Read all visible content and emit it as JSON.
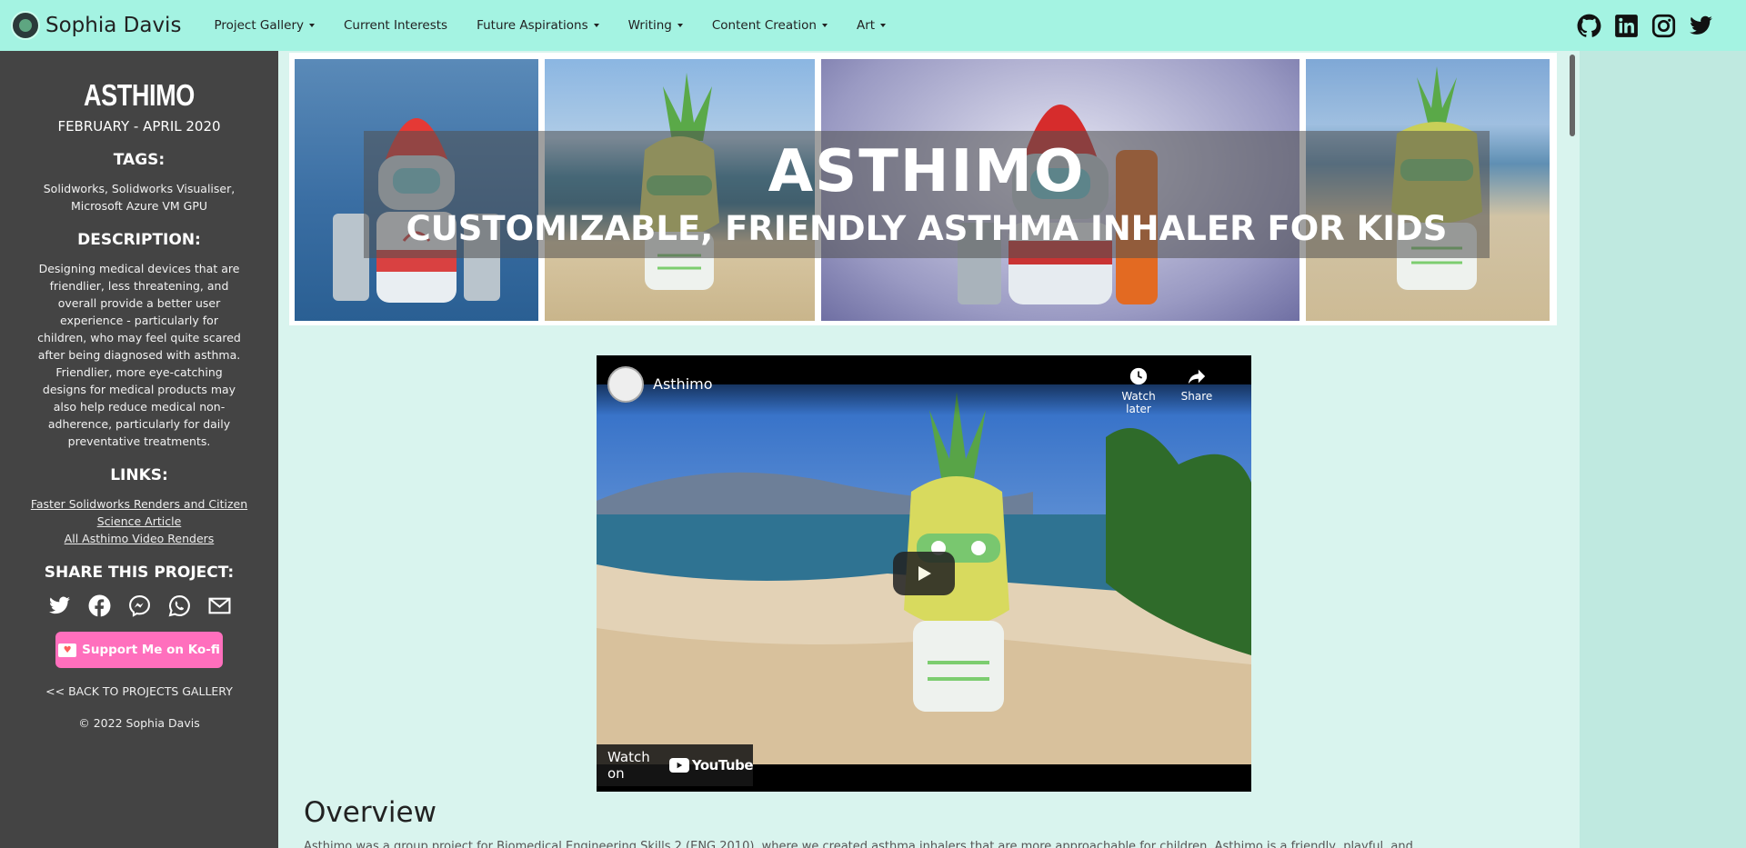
{
  "nav": {
    "brand": "Sophia Davis",
    "items": [
      {
        "label": "Project Gallery",
        "dropdown": true
      },
      {
        "label": "Current Interests",
        "dropdown": false
      },
      {
        "label": "Future Aspirations",
        "dropdown": true
      },
      {
        "label": "Writing",
        "dropdown": true
      },
      {
        "label": "Content Creation",
        "dropdown": true
      },
      {
        "label": "Art",
        "dropdown": true
      }
    ],
    "social_icons": [
      "github-icon",
      "linkedin-icon",
      "instagram-icon",
      "twitter-icon"
    ]
  },
  "sidebar": {
    "title": "ASTHIMO",
    "dates": "FEBRUARY - APRIL 2020",
    "tags_heading": "TAGS:",
    "tags": "Solidworks, Solidworks Visualiser, Microsoft Azure VM GPU",
    "description_heading": "DESCRIPTION:",
    "description": "Designing medical devices that are friendlier, less threatening, and overall provide a better user experience - particularly for children, who may feel quite scared after being diagnosed with asthma. Friendlier, more eye-catching designs for medical products may also help reduce medical non-adherence, particularly for daily preventative treatments.",
    "links_heading": "LINKS:",
    "links": [
      "Faster Solidworks Renders and Citizen Science Article",
      "All Asthimo Video Renders"
    ],
    "share_heading": "SHARE THIS PROJECT:",
    "share_icons": [
      "twitter-icon",
      "facebook-icon",
      "messenger-icon",
      "whatsapp-icon",
      "email-icon"
    ],
    "kofi_label": "Support Me on Ko-fi",
    "back_label": "<< BACK TO PROJECTS GALLERY",
    "copyright": "© 2022 Sophia Davis"
  },
  "banner": {
    "title": "ASTHIMO",
    "subtitle": "CUSTOMIZABLE, FRIENDLY ASTHMA INHALER FOR KIDS"
  },
  "video": {
    "title": "Asthimo",
    "watch_later": "Watch later",
    "share": "Share",
    "watch_on": "Watch on",
    "youtube": "YouTube"
  },
  "content": {
    "heading": "Overview",
    "text_partial": "Asthimo was a group project for Biomedical Engineering Skills 2 (ENG 2010), where we created asthma inhalers that are more approachable for children. Asthimo is a friendly, playful, and..."
  },
  "colors": {
    "navbar": "#a4f3e2",
    "sidebar": "#444444",
    "main_bg": "#d9f4ee",
    "kofi": "#ff6fbd"
  }
}
